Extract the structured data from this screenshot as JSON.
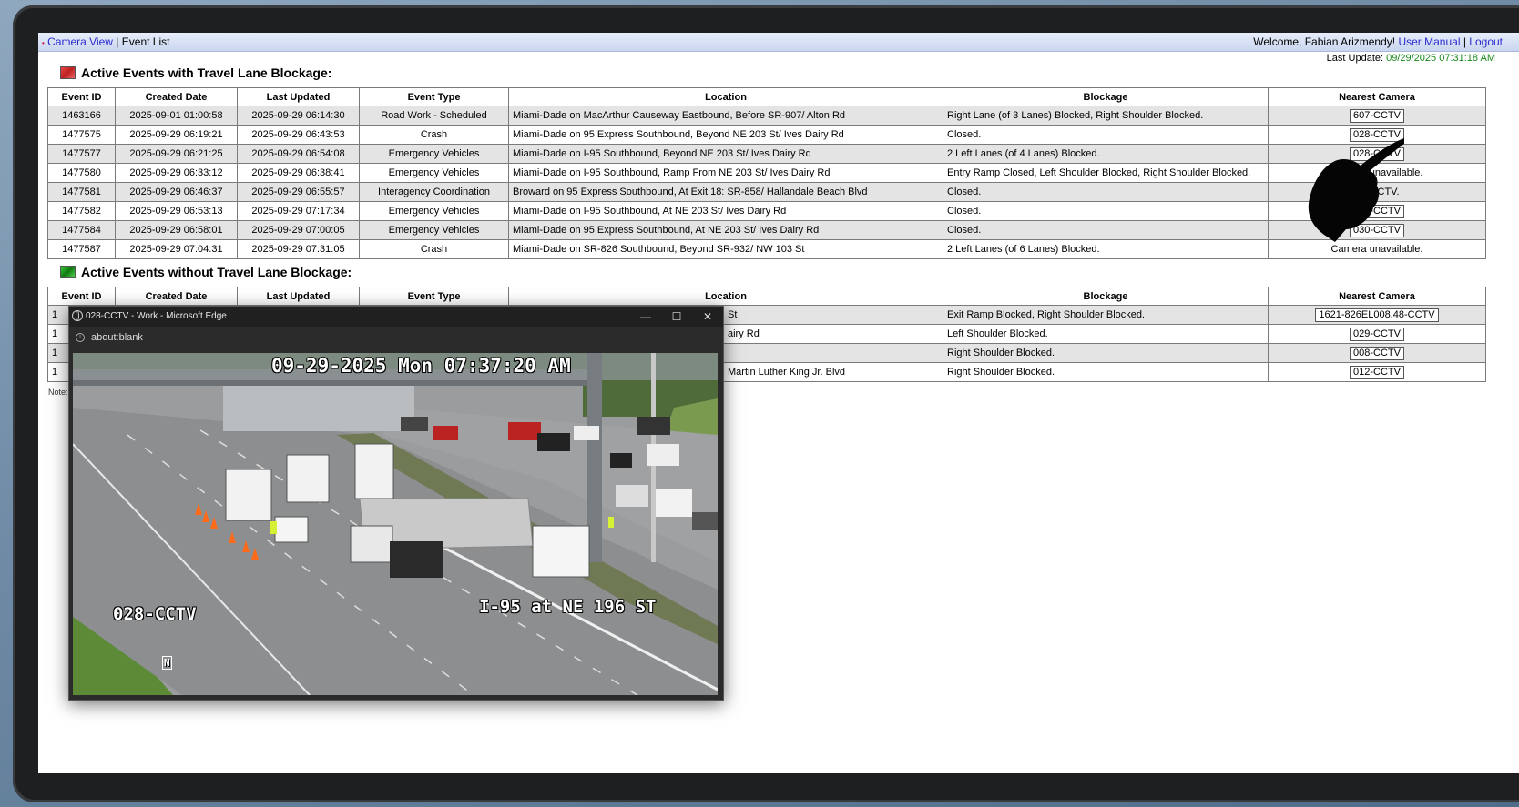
{
  "header": {
    "nav_camera_view": "Camera View",
    "nav_sep": " | ",
    "nav_event_list": "Event List",
    "welcome": "Welcome, Fabian Arizmendy!",
    "user_manual": "User Manual",
    "logout": "Logout",
    "last_update_label": "Last Update:",
    "last_update_value": "09/29/2025 07:31:18 AM"
  },
  "blocking": {
    "title": "Active Events with Travel Lane Blockage:",
    "columns": [
      "Event ID",
      "Created Date",
      "Last Updated",
      "Event Type",
      "Location",
      "Blockage",
      "Nearest Camera"
    ],
    "rows": [
      {
        "id": "1463166",
        "created": "2025-09-01 01:00:58",
        "updated": "2025-09-29 06:14:30",
        "type": "Road Work - Scheduled",
        "location": "Miami-Dade on MacArthur Causeway Eastbound, Before SR-907/ Alton Rd",
        "blockage": "Right Lane (of 3 Lanes) Blocked, Right Shoulder Blocked.",
        "camera": "607-CCTV"
      },
      {
        "id": "1477575",
        "created": "2025-09-29 06:19:21",
        "updated": "2025-09-29 06:43:53",
        "type": "Crash",
        "location": "Miami-Dade on 95 Express Southbound, Beyond NE 203 St/ Ives Dairy Rd",
        "blockage": "Closed.",
        "camera": "028-CCTV"
      },
      {
        "id": "1477577",
        "created": "2025-09-29 06:21:25",
        "updated": "2025-09-29 06:54:08",
        "type": "Emergency Vehicles",
        "location": "Miami-Dade on I-95 Southbound, Beyond NE 203 St/ Ives Dairy Rd",
        "blockage": "2 Left Lanes (of 4 Lanes) Blocked.",
        "camera": "028-CCTV"
      },
      {
        "id": "1477580",
        "created": "2025-09-29 06:33:12",
        "updated": "2025-09-29 06:38:41",
        "type": "Emergency Vehicles",
        "location": "Miami-Dade on I-95 Southbound, Ramp From NE 203 St/ Ives Dairy Rd",
        "blockage": "Entry Ramp Closed, Left Shoulder Blocked, Right Shoulder Blocked.",
        "camera": "Camera unavailable."
      },
      {
        "id": "1477581",
        "created": "2025-09-29 06:46:37",
        "updated": "2025-09-29 06:55:57",
        "type": "Interagency Coordination",
        "location": "Broward on 95 Express Southbound, At Exit 18: SR-858/ Hallandale Beach Blvd",
        "blockage": "Closed.",
        "camera": "No CCTV."
      },
      {
        "id": "1477582",
        "created": "2025-09-29 06:53:13",
        "updated": "2025-09-29 07:17:34",
        "type": "Emergency Vehicles",
        "location": "Miami-Dade on I-95 Southbound, At NE 203 St/ Ives Dairy Rd",
        "blockage": "Closed.",
        "camera": "030-CCTV"
      },
      {
        "id": "1477584",
        "created": "2025-09-29 06:58:01",
        "updated": "2025-09-29 07:00:05",
        "type": "Emergency Vehicles",
        "location": "Miami-Dade on 95 Express Southbound, At NE 203 St/ Ives Dairy Rd",
        "blockage": "Closed.",
        "camera": "030-CCTV"
      },
      {
        "id": "1477587",
        "created": "2025-09-29 07:04:31",
        "updated": "2025-09-29 07:31:05",
        "type": "Crash",
        "location": "Miami-Dade on SR-826 Southbound, Beyond SR-932/ NW 103 St",
        "blockage": "2 Left Lanes (of 6 Lanes) Blocked.",
        "camera": "Camera unavailable."
      }
    ]
  },
  "nonblocking": {
    "title": "Active Events without Travel Lane Blockage:",
    "columns": [
      "Event ID",
      "Created Date",
      "Last Updated",
      "Event Type",
      "Location",
      "Blockage",
      "Nearest Camera"
    ],
    "rows": [
      {
        "id": "1",
        "location": "St",
        "blockage": "Exit Ramp Blocked, Right Shoulder Blocked.",
        "camera": "1621-826EL008.48-CCTV"
      },
      {
        "id": "1",
        "location": "airy Rd",
        "blockage": "Left Shoulder Blocked.",
        "camera": "029-CCTV"
      },
      {
        "id": "1",
        "location": "",
        "blockage": "Right Shoulder Blocked.",
        "camera": "008-CCTV"
      },
      {
        "id": "1",
        "location": "Martin Luther King Jr. Blvd",
        "blockage": "Right Shoulder Blocked.",
        "camera": "012-CCTV"
      }
    ],
    "note": "Note:"
  },
  "popup": {
    "title": "028-CCTV - Work - Microsoft Edge",
    "url": "about:blank",
    "minimize": "—",
    "maximize": "☐",
    "close": "✕",
    "feed_timestamp": "09-29-2025 Mon 07:37:20 AM",
    "feed_camera_id": "028-CCTV",
    "feed_location": "I-95 at NE 196 ST",
    "feed_north": "N"
  },
  "colors": {
    "link": "#2b2bcc",
    "timestamp": "#1a8a1a",
    "row_shade": "#e4e4e4"
  }
}
